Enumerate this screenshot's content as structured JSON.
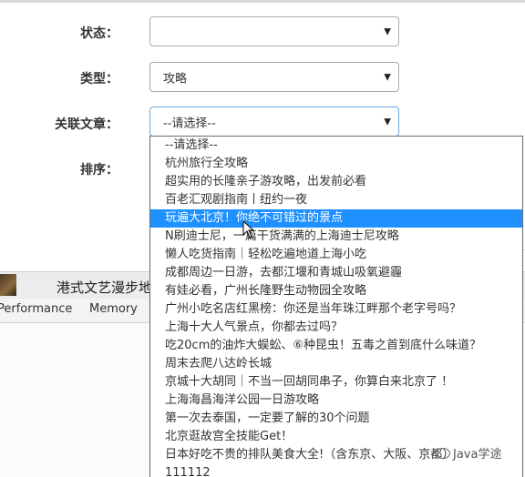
{
  "form": {
    "status_label": "状态：",
    "status_value": "",
    "type_label": "类型：",
    "type_value": "攻略",
    "article_label": "关联文章：",
    "article_value": "--请选择--",
    "order_label": "排序："
  },
  "background": {
    "banner_title": "港式文艺漫步地",
    "tabs": [
      "Performance",
      "Memory"
    ]
  },
  "dropdown": {
    "selected_index": 4,
    "options": [
      "--请选择--",
      "杭州旅行全攻略",
      "超实用的长隆亲子游攻略，出发前必看",
      "百老汇观剧指南丨纽约一夜",
      "玩遍大北京！你绝不可错过的景点",
      "N刷迪士尼，一篇干货满满的上海迪士尼攻略",
      "懒人吃货指南｜轻松吃遍地道上海小吃",
      "成都周边一日游，去都江堰和青城山吸氧避霾",
      "有娃必看，广州长隆野生动物园全攻略",
      "广州小吃名店红黑榜：你还是当年珠江畔那个老字号吗？",
      "上海十大人气景点，你都去过吗？",
      "吃20cm的油炸大蜈蚣、⑥种昆虫！五毒之首到底什么味道？",
      "周末去爬八达岭长城",
      "京城十大胡同｜不当一回胡同串子，你算白来北京了 ！",
      "上海海昌海洋公园一日游攻略",
      "第一次去泰国，一定要了解的30个问题",
      "北京逛故宫全技能Get！",
      "日本好吃不贵的排队美食大全!（含东京、大阪、京都）",
      "111112"
    ]
  },
  "watermark": {
    "text": "Java学途"
  }
}
